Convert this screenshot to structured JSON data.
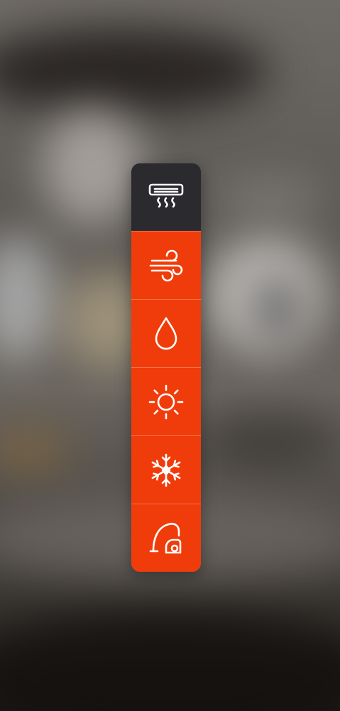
{
  "background": {
    "description_icon": "blurred-kitchen-background"
  },
  "colors": {
    "active_bg": "#2b2a2f",
    "inactive_bg": "#f03c0a",
    "icon": "#ffffff"
  },
  "mode_panel": {
    "selected_index": 0,
    "modes": [
      {
        "id": "air-conditioner",
        "icon": "air-conditioner-icon",
        "active": true
      },
      {
        "id": "fan",
        "icon": "wind-icon",
        "active": false
      },
      {
        "id": "dry",
        "icon": "water-drop-icon",
        "active": false
      },
      {
        "id": "heat",
        "icon": "sun-icon",
        "active": false
      },
      {
        "id": "cool",
        "icon": "snowflake-icon",
        "active": false
      },
      {
        "id": "clean",
        "icon": "vacuum-cleaner-icon",
        "active": false
      }
    ]
  }
}
